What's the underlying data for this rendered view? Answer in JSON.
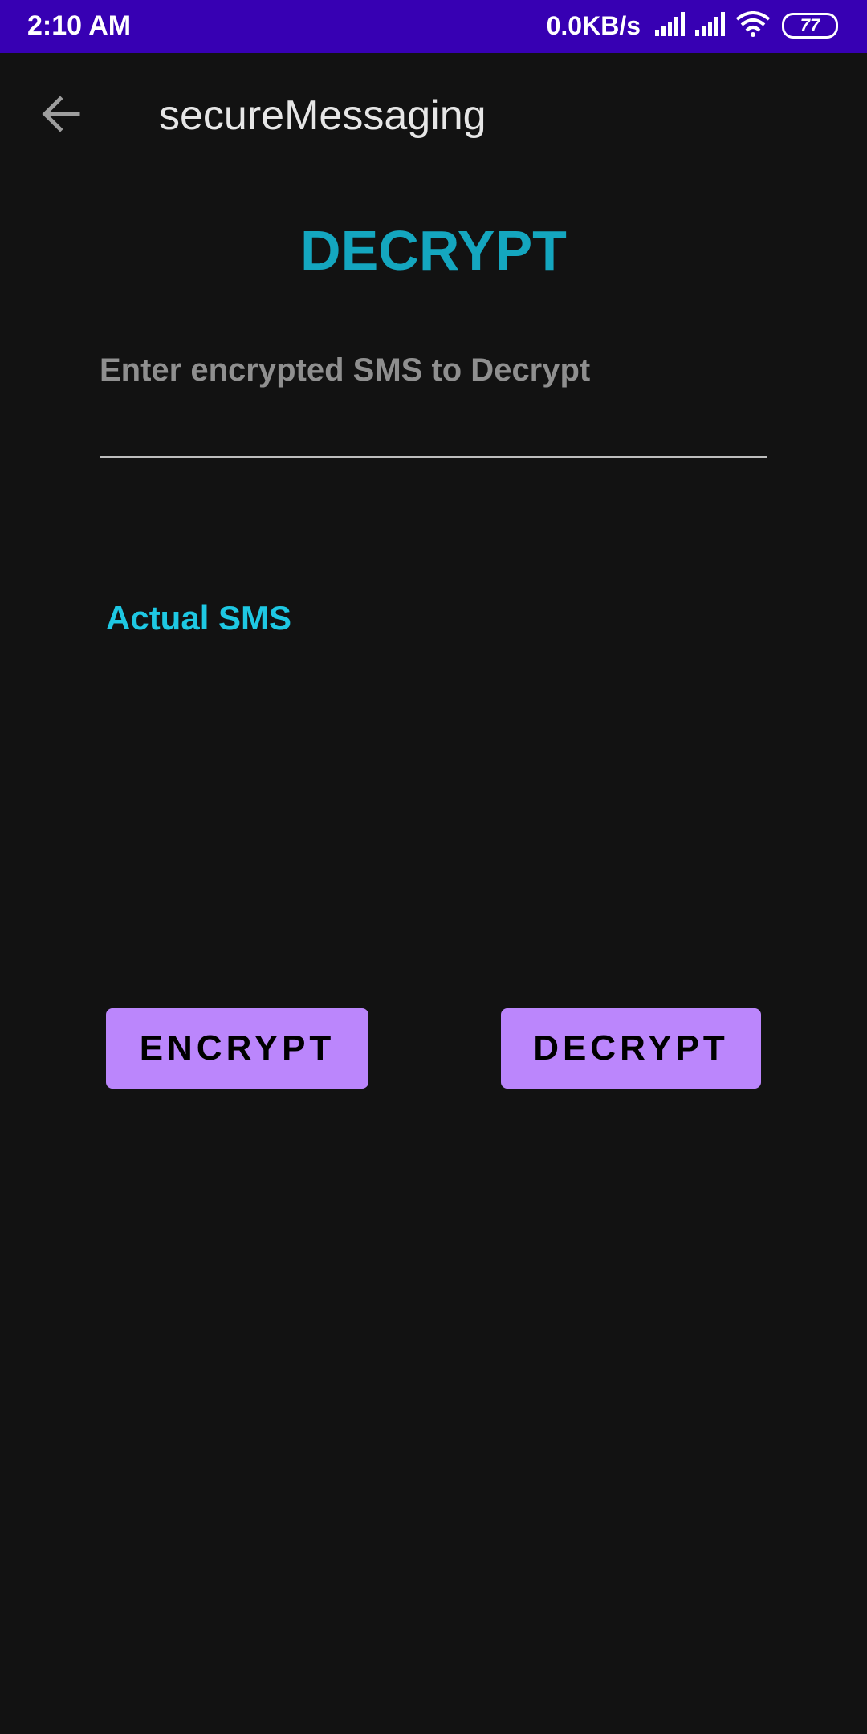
{
  "status_bar": {
    "time": "2:10 AM",
    "network_speed": "0.0KB/s",
    "battery_level": "77",
    "icons": [
      "signal-icon",
      "signal-icon",
      "wifi-icon",
      "battery-icon"
    ],
    "background_color": "#3700b3"
  },
  "app_bar": {
    "title": "secureMessaging",
    "back_icon": "arrow-left-icon"
  },
  "main": {
    "heading": "DECRYPT",
    "input": {
      "placeholder": "Enter encrypted SMS to Decrypt",
      "value": ""
    },
    "result_label": "Actual SMS",
    "buttons": {
      "encrypt_label": "ENCRYPT",
      "decrypt_label": "DECRYPT"
    }
  },
  "colors": {
    "background": "#121212",
    "heading": "#14a6bf",
    "result_label": "#1ec8e3",
    "button_background": "#bb86fc"
  }
}
